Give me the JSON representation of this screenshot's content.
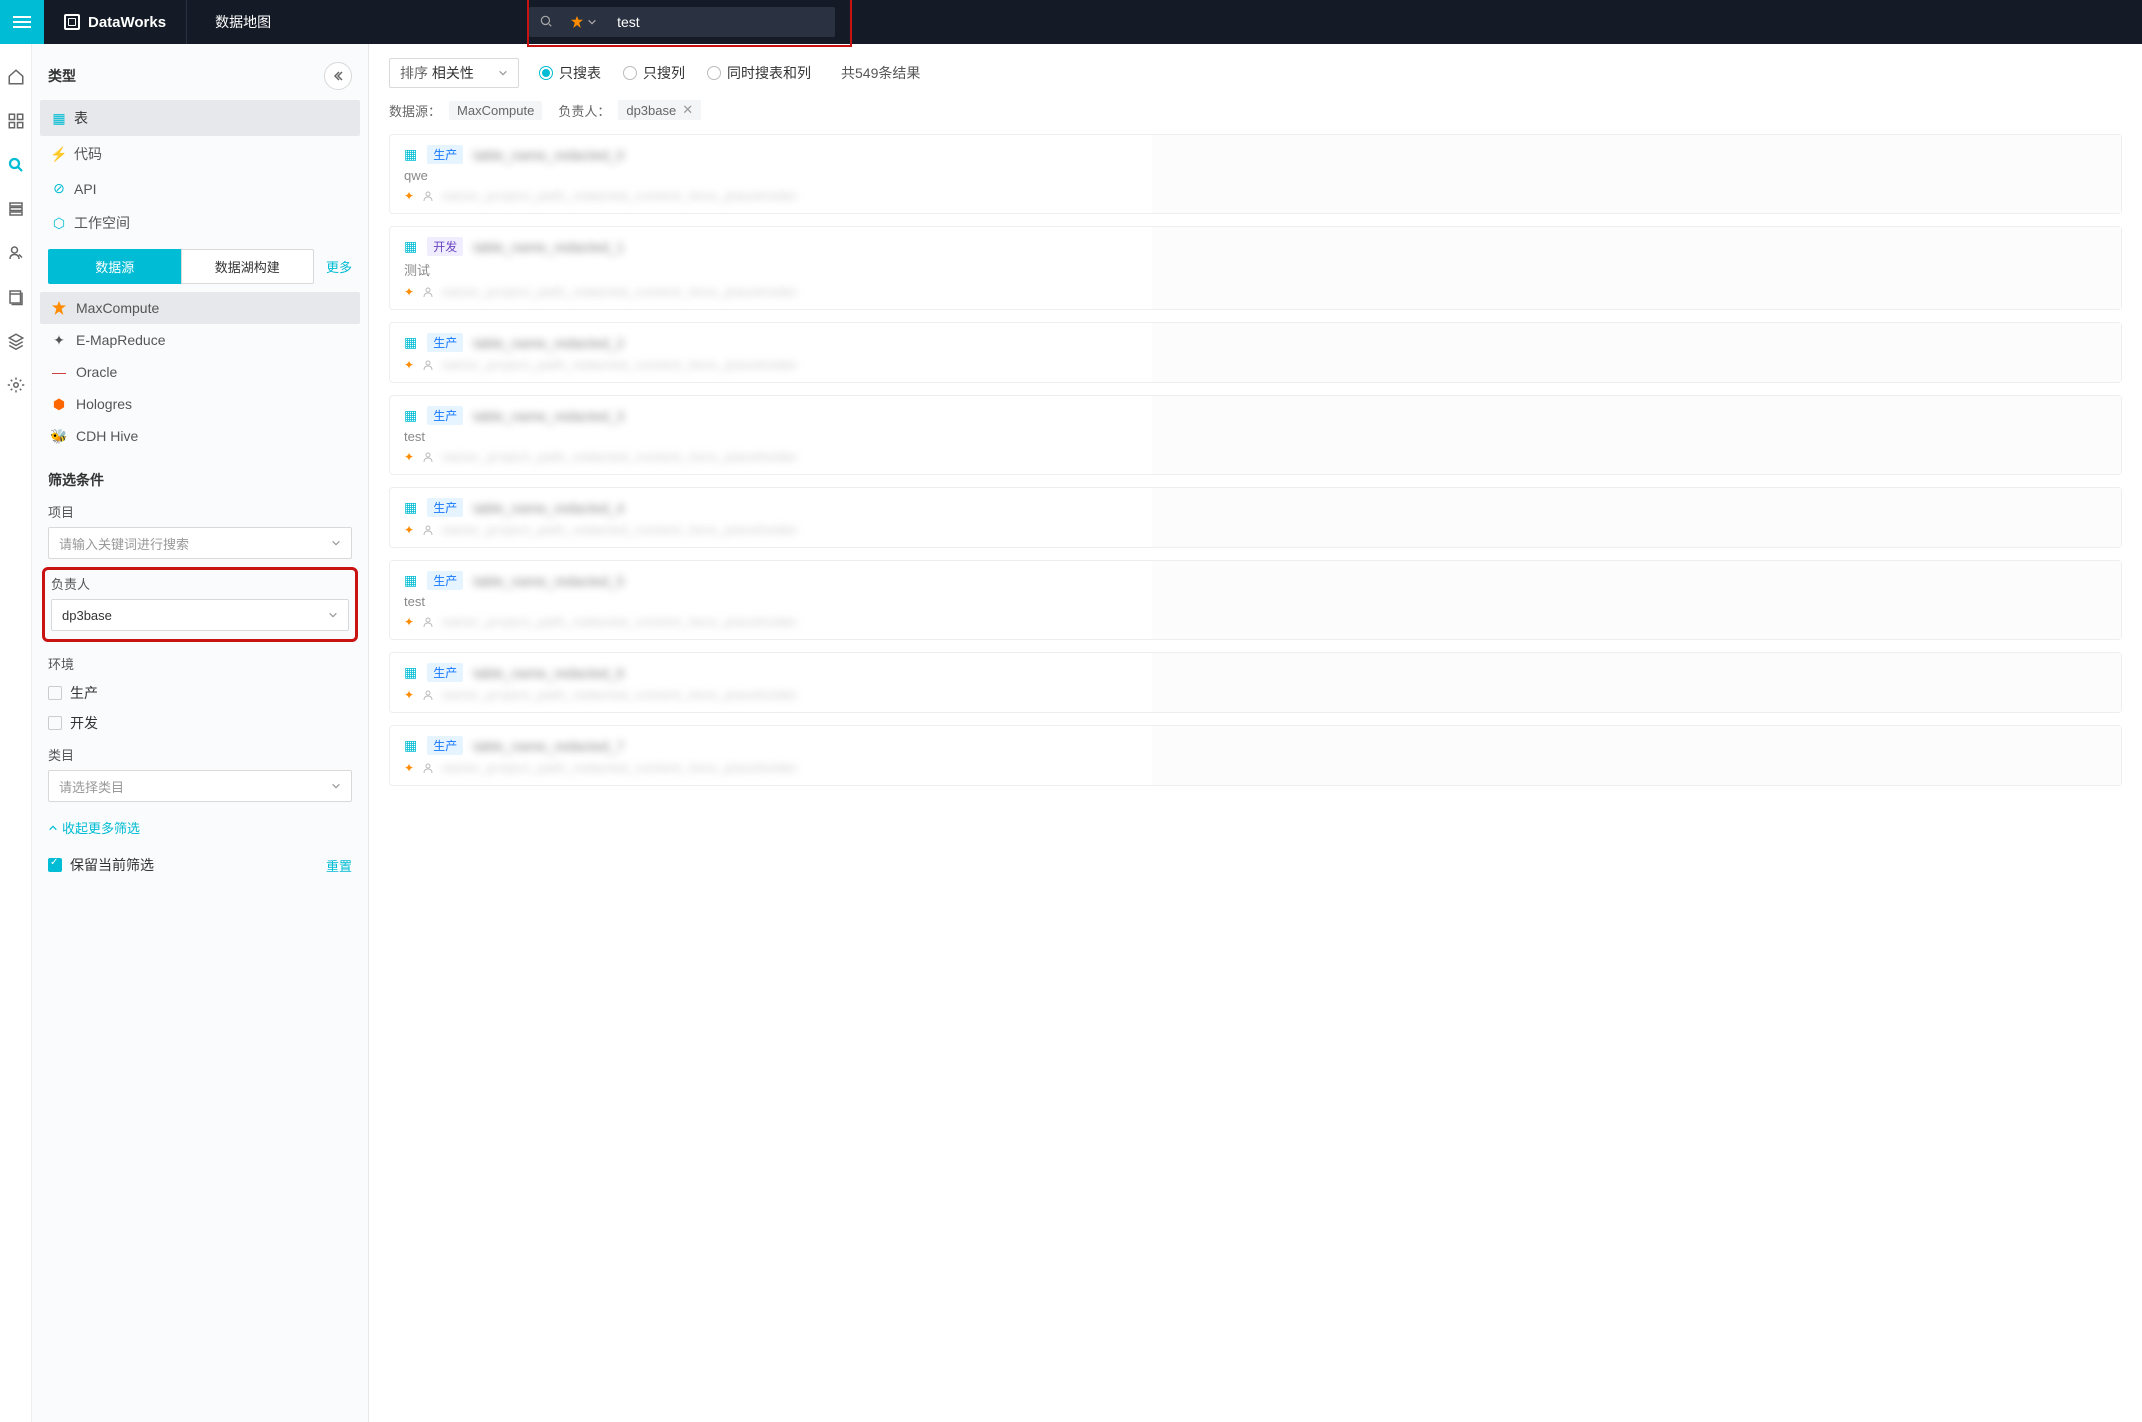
{
  "topbar": {
    "brand": "DataWorks",
    "tab": "数据地图",
    "search_value": "test"
  },
  "sidebar": {
    "type_section_title": "类型",
    "types": {
      "table": "表",
      "code": "代码",
      "api": "API",
      "workspace": "工作空间"
    },
    "tabs": {
      "datasource": "数据源",
      "datalake": "数据湖构建",
      "more": "更多"
    },
    "datasources": {
      "maxcompute": "MaxCompute",
      "emapreduce": "E-MapReduce",
      "oracle": "Oracle",
      "hologres": "Hologres",
      "cdhhive": "CDH Hive"
    },
    "filters_title": "筛选条件",
    "project_label": "项目",
    "project_placeholder": "请输入关键词进行搜索",
    "owner_label": "负责人",
    "owner_value": "dp3base",
    "env_label": "环境",
    "env_prod": "生产",
    "env_dev": "开发",
    "category_label": "类目",
    "category_placeholder": "请选择类目",
    "collapse_more": "收起更多筛选",
    "keep_filter": "保留当前筛选",
    "reset": "重置"
  },
  "main": {
    "sort_label": "排序",
    "sort_value": "相关性",
    "radio_table": "只搜表",
    "radio_column": "只搜列",
    "radio_both": "同时搜表和列",
    "result_count": "共549条结果",
    "chip_source_label": "数据源：",
    "chip_source_value": "MaxCompute",
    "chip_owner_label": "负责人：",
    "chip_owner_value": "dp3base",
    "results": [
      {
        "env": "生产",
        "env_class": "prod",
        "sub": "qwe"
      },
      {
        "env": "开发",
        "env_class": "dev",
        "sub": "测试"
      },
      {
        "env": "生产",
        "env_class": "prod",
        "sub": ""
      },
      {
        "env": "生产",
        "env_class": "prod",
        "sub": "test"
      },
      {
        "env": "生产",
        "env_class": "prod",
        "sub": ""
      },
      {
        "env": "生产",
        "env_class": "prod",
        "sub": "test"
      },
      {
        "env": "生产",
        "env_class": "prod",
        "sub": ""
      },
      {
        "env": "生产",
        "env_class": "prod",
        "sub": ""
      }
    ]
  }
}
